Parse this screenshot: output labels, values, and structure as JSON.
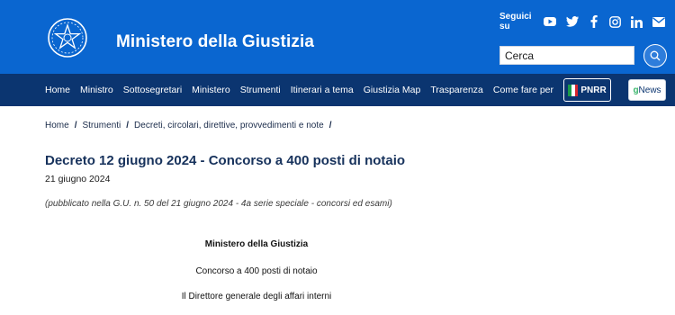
{
  "header": {
    "site_title": "Ministero della Giustizia",
    "social_label": "Seguici su",
    "social_icons": [
      "youtube-icon",
      "twitter-icon",
      "facebook-icon",
      "instagram-icon",
      "linkedin-icon",
      "mail-icon"
    ],
    "search_placeholder": "Cerca",
    "brand_color": "#0a66d0"
  },
  "nav": {
    "items": [
      "Home",
      "Ministro",
      "Sottosegretari",
      "Ministero",
      "Strumenti",
      "Itinerari a tema",
      "Giustizia Map",
      "Trasparenza",
      "Come fare per"
    ],
    "pnrr_label": "PNRR",
    "gnews_g": "g",
    "gnews_rest": "News",
    "background": "#0b3570"
  },
  "breadcrumb": [
    "Home",
    "Strumenti",
    "Decreti, circolari, direttive, provvedimenti e note"
  ],
  "breadcrumb_sep": "/",
  "article": {
    "title": "Decreto 12 giugno 2024 - Concorso a 400 posti di notaio",
    "date": "21 giugno 2024",
    "publication_note": "(pubblicato nella G.U. n. 50 del 21 giugno 2024 - 4a serie speciale - concorsi ed esami)",
    "lines": [
      "Ministero della Giustizia",
      "Concorso a 400 posti di notaio",
      "Il Direttore generale degli affari interni"
    ]
  }
}
